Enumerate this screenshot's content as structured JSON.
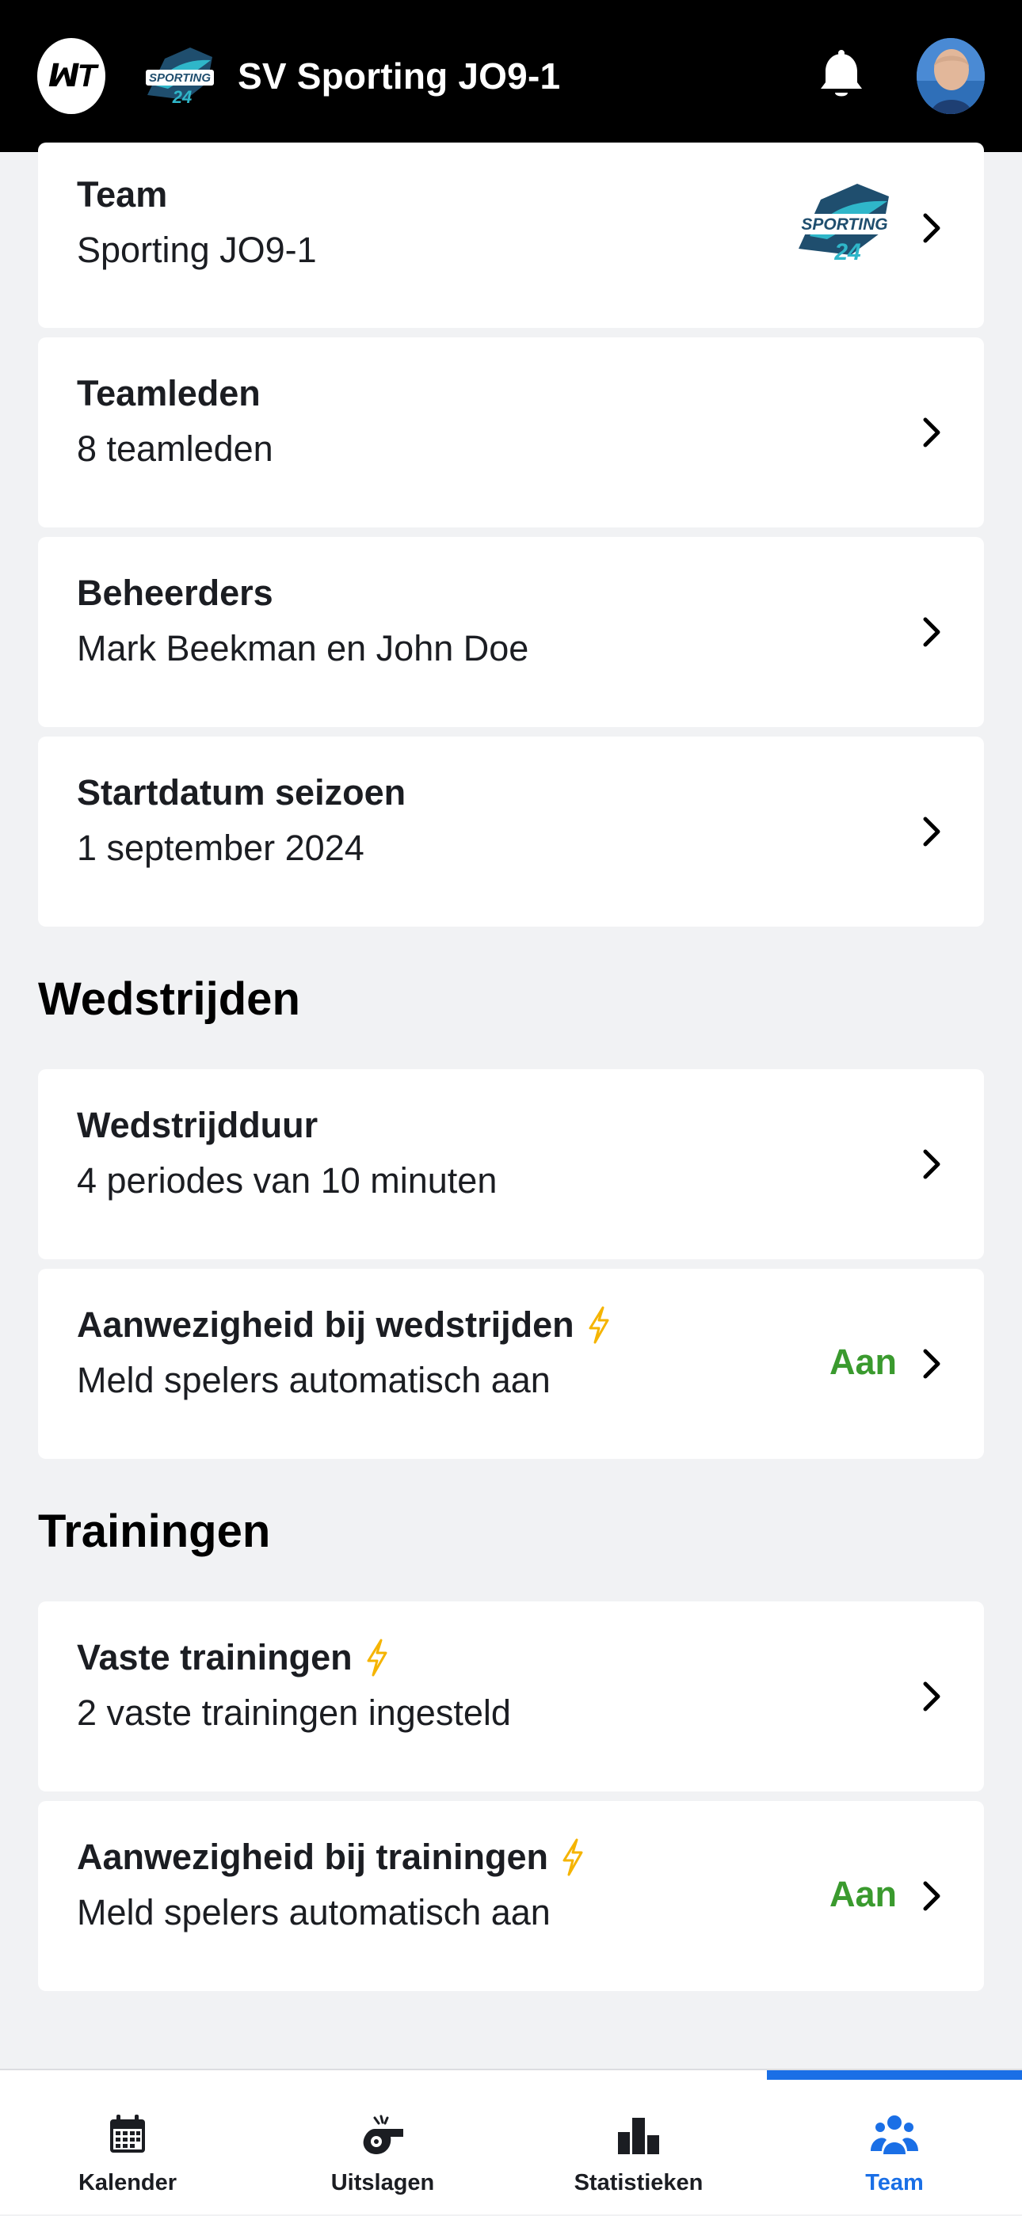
{
  "header": {
    "title": "SV Sporting JO9-1",
    "app_logo_text": "ꟽT",
    "badge_icon": "team-logo",
    "bell_icon": "bell-icon",
    "avatar_icon": "user-avatar"
  },
  "team_section": {
    "cards": [
      {
        "label": "Team",
        "value": "Sporting JO9-1",
        "has_logo": true
      },
      {
        "label": "Teamleden",
        "value": "8 teamleden"
      },
      {
        "label": "Beheerders",
        "value": "Mark Beekman en John Doe"
      },
      {
        "label": "Startdatum seizoen",
        "value": "1 september 2024"
      }
    ]
  },
  "matches_section": {
    "heading": "Wedstrijden",
    "cards": [
      {
        "label": "Wedstrijdduur",
        "value": "4 periodes van 10 minuten"
      },
      {
        "label": "Aanwezigheid bij wedstrijden",
        "value": "Meld spelers automatisch aan",
        "status": "Aan",
        "premium": true
      }
    ]
  },
  "trainings_section": {
    "heading": "Trainingen",
    "cards": [
      {
        "label": "Vaste trainingen",
        "value": "2 vaste trainingen ingesteld",
        "premium": true
      },
      {
        "label": "Aanwezigheid bij trainingen",
        "value": "Meld spelers automatisch aan",
        "status": "Aan",
        "premium": true
      }
    ]
  },
  "tabbar": {
    "tabs": [
      {
        "label": "Kalender",
        "icon": "calendar-icon"
      },
      {
        "label": "Uitslagen",
        "icon": "whistle-icon"
      },
      {
        "label": "Statistieken",
        "icon": "bar-chart-icon"
      },
      {
        "label": "Team",
        "icon": "team-icon",
        "active": true
      }
    ]
  },
  "colors": {
    "accent": "#1a6fe6",
    "status_on": "#3a9a2e",
    "premium_bolt": "#f5b400",
    "header_bg": "#000000",
    "page_bg": "#f1f2f4"
  }
}
